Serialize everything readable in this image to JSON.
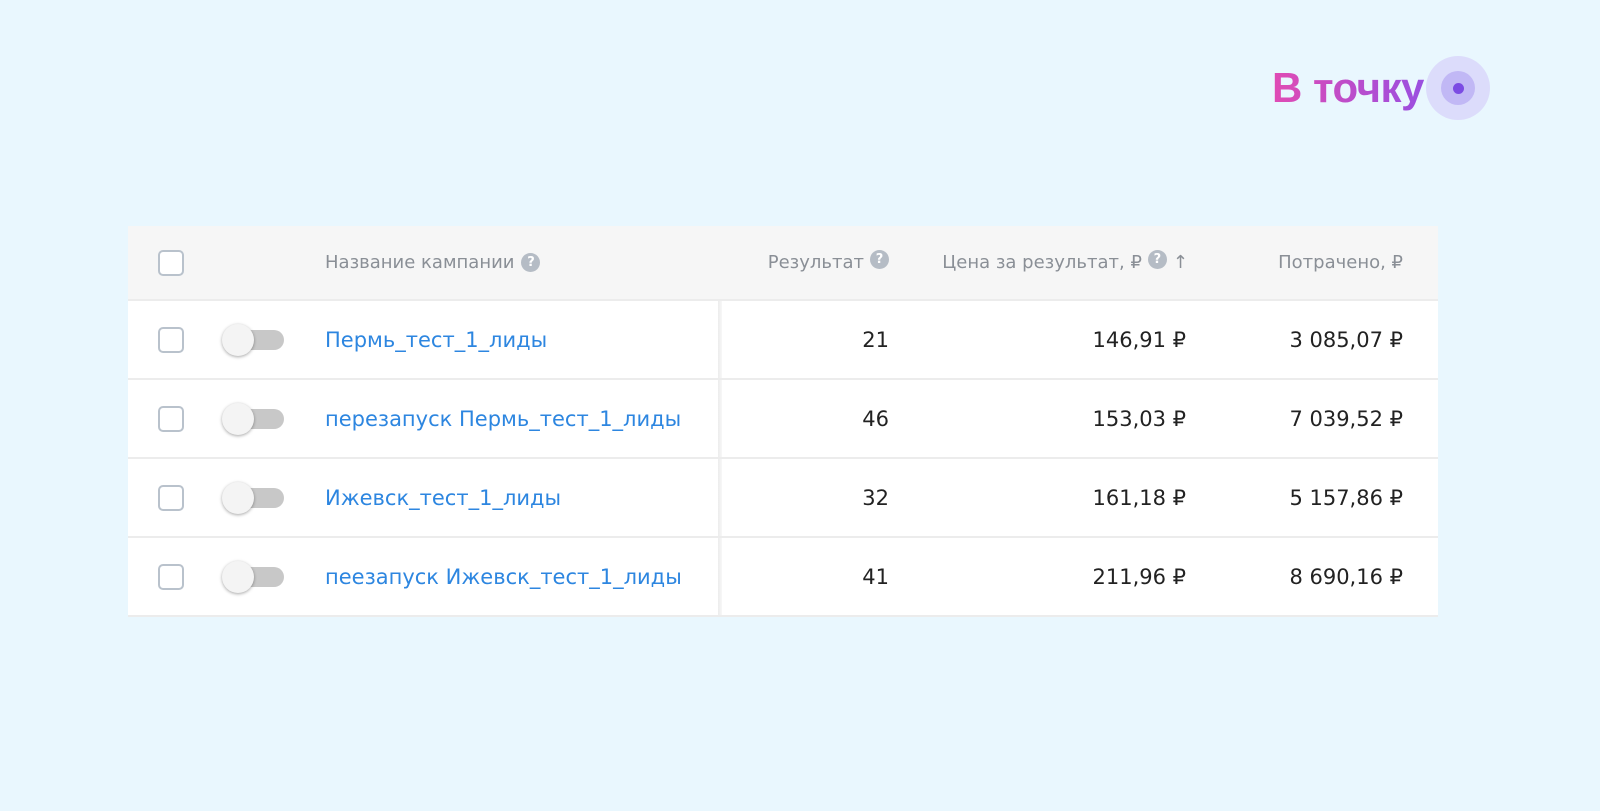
{
  "logo": {
    "text": "В точку",
    "colors": {
      "start": "#e04bb4",
      "end": "#9a4fe0"
    }
  },
  "table": {
    "headers": {
      "name": "Название кампании",
      "result": "Результат",
      "price": "Цена за результат, ₽",
      "sort_indicator": "↑",
      "spent": "Потрачено, ₽",
      "help_icon": "?"
    },
    "rows": [
      {
        "name": "Пермь_тест_1_лиды",
        "result": "21",
        "price": "146,91 ₽",
        "spent": "3 085,07 ₽",
        "enabled": false,
        "checked": false
      },
      {
        "name": "перезапуск Пермь_тест_1_лиды",
        "result": "46",
        "price": "153,03 ₽",
        "spent": "7 039,52 ₽",
        "enabled": false,
        "checked": false
      },
      {
        "name": "Ижевск_тест_1_лиды",
        "result": "32",
        "price": "161,18 ₽",
        "spent": "5 157,86 ₽",
        "enabled": false,
        "checked": false
      },
      {
        "name": "пеезапуск Ижевск_тест_1_лиды",
        "result": "41",
        "price": "211,96 ₽",
        "spent": "8 690,16 ₽",
        "enabled": false,
        "checked": false
      }
    ]
  },
  "colors": {
    "link": "#2d86e0",
    "background": "#e9f7fe"
  }
}
